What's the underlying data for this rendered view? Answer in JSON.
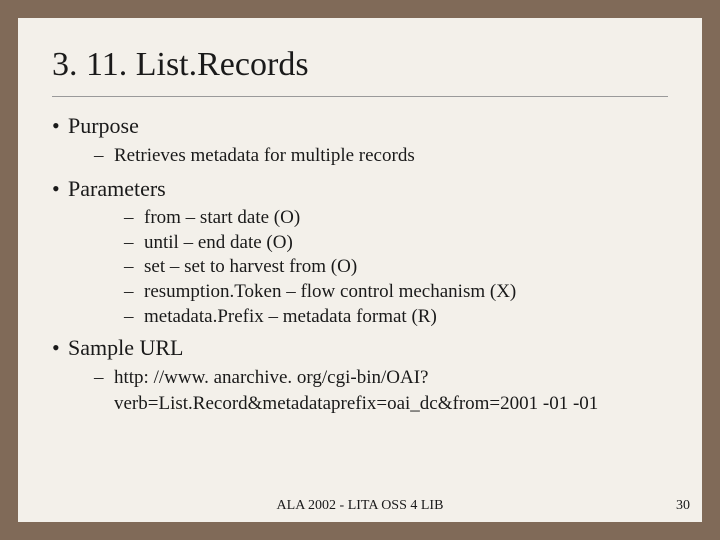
{
  "title": "3. 11. List.Records",
  "bullets": {
    "purpose": {
      "label": "Purpose",
      "items": [
        "Retrieves metadata for multiple records"
      ]
    },
    "parameters": {
      "label": "Parameters",
      "items": [
        "from – start date (O)",
        "until – end date (O)",
        "set – set to harvest from (O)",
        "resumption.Token – flow control mechanism (X)",
        "metadata.Prefix – metadata format (R)"
      ]
    },
    "sample": {
      "label": "Sample URL",
      "items": [
        "http: //www. anarchive. org/cgi-bin/OAI? verb=List.Record&metadataprefix=oai_dc&from=2001 -01 -01"
      ]
    }
  },
  "footer": "ALA 2002 - LITA OSS 4 LIB",
  "page": "30",
  "glyphs": {
    "bullet": "•",
    "dash": "–"
  }
}
